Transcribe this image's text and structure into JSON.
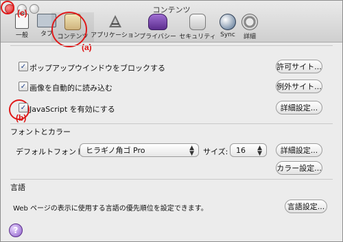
{
  "window": {
    "title": "コンテンツ"
  },
  "toolbar": {
    "items": [
      {
        "label": "一般"
      },
      {
        "label": "タブ"
      },
      {
        "label": "コンテンツ"
      },
      {
        "label": "アプリケーション"
      },
      {
        "label": "プライバシー"
      },
      {
        "label": "セキュリティ"
      },
      {
        "label": "Sync"
      },
      {
        "label": "詳細"
      }
    ]
  },
  "annotations": {
    "a": "(a)",
    "b": "(b)",
    "c": "(c)"
  },
  "content": {
    "popup_block": {
      "label": "ポップアップウインドウをブロックする",
      "checked": true,
      "button": "許可サイト..."
    },
    "auto_images": {
      "label": "画像を自動的に読み込む",
      "checked": true,
      "button": "例外サイト..."
    },
    "javascript": {
      "label": "JavaScript を有効にする",
      "checked": true,
      "button": "詳細設定..."
    },
    "fonts_colors": {
      "section": "フォントとカラー",
      "default_font_label": "デフォルトフォント:",
      "font_value": "ヒラギノ角ゴ Pro",
      "size_label": "サイズ:",
      "size_value": "16",
      "advanced_button": "詳細設定...",
      "colors_button": "カラー設定..."
    },
    "languages": {
      "section": "言語",
      "description": "Web ページの表示に使用する言語の優先順位を設定できます。",
      "button": "言語設定..."
    }
  },
  "help": {
    "label": "?"
  }
}
